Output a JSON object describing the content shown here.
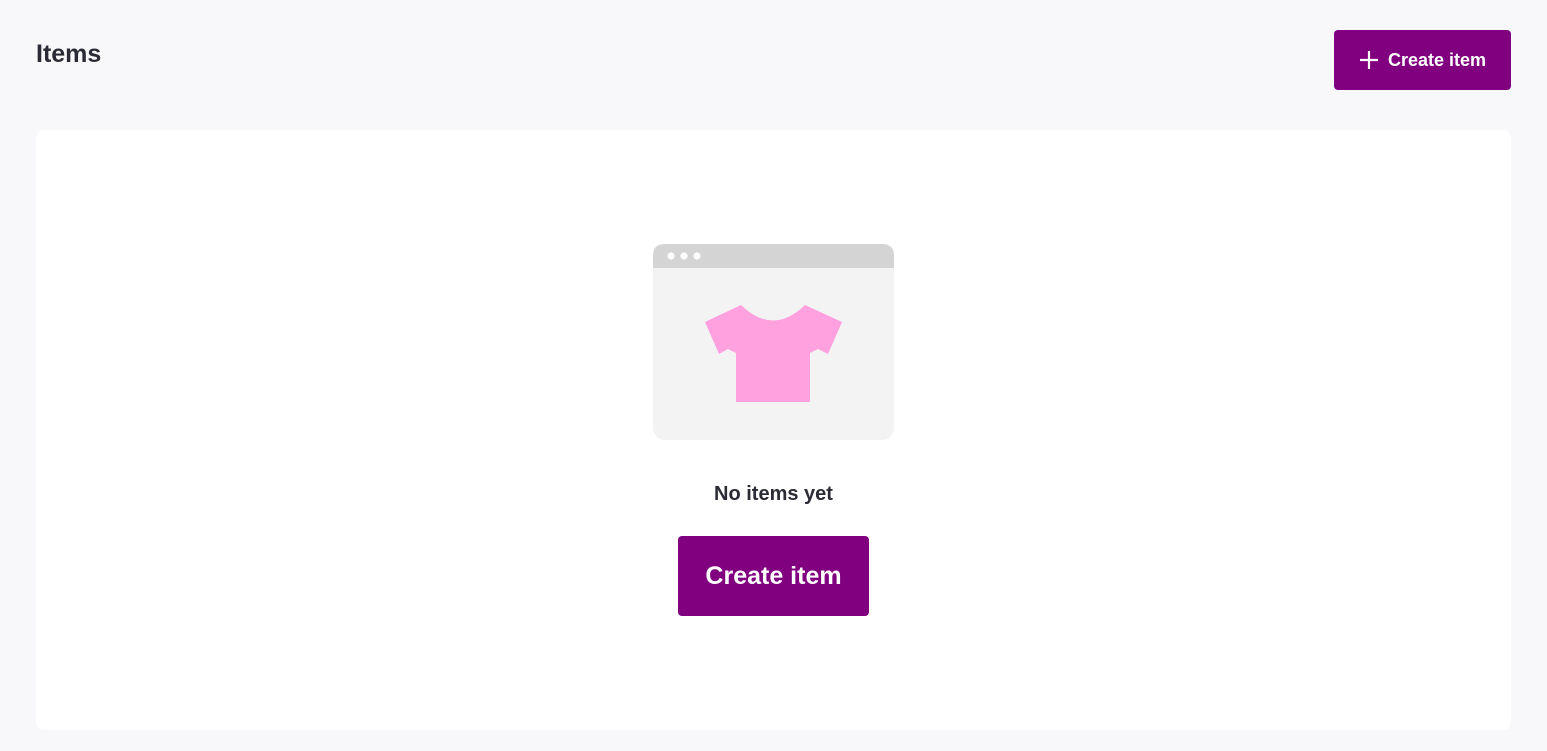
{
  "header": {
    "title": "Items",
    "create_button_label": "Create item"
  },
  "empty_state": {
    "message": "No items yet",
    "create_button_label": "Create item",
    "illustration_icon": "tshirt-in-browser-window-icon"
  },
  "colors": {
    "accent": "#800080",
    "page_background": "#f8f8fa",
    "card_background": "#ffffff",
    "illustration_shirt": "#ffa0df",
    "illustration_window": "#f3f3f3",
    "illustration_titlebar": "#d4d4d4"
  }
}
